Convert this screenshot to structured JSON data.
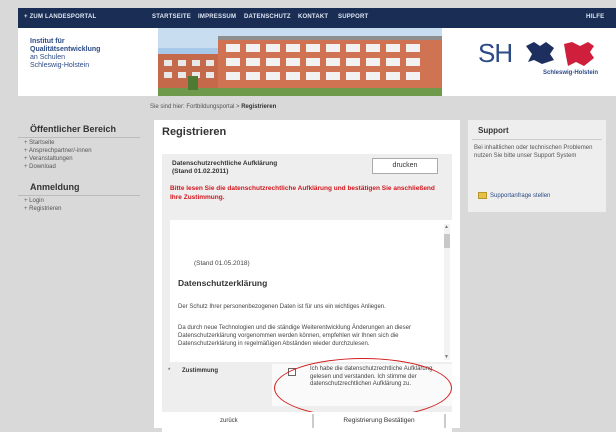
{
  "topnav": {
    "portal": "+ ZUM LANDESPORTAL",
    "items": [
      "STARTSEITE",
      "IMPRESSUM",
      "DATENSCHUTZ",
      "KONTAKT",
      "SUPPORT"
    ],
    "help": "HILFE"
  },
  "header": {
    "inst_line1": "Institut für",
    "inst_line2": "Qualitätsentwicklung",
    "inst_line3": "an Schulen",
    "inst_line4": "Schleswig-Holstein",
    "logo_text": "SH",
    "logo_sub": "Schleswig-Holstein"
  },
  "breadcrumb": {
    "prefix": "Sie sind hier: Fortbildungsportal > ",
    "current": "Registrieren"
  },
  "sidebar": {
    "section1": "Öffentlicher Bereich",
    "items1": [
      "Startseite",
      "Ansprechpartner/-innen",
      "Veranstaltungen",
      "Download"
    ],
    "section2": "Anmeldung",
    "items2": [
      "Login",
      "Registrieren"
    ]
  },
  "main": {
    "title": "Registrieren",
    "dsg_title_1": "Datenschutzrechtliche Aufklärung",
    "dsg_title_2": "(Stand 01.02.2011)",
    "print_label": "drucken",
    "warning": "Bitte lesen Sie die datenschutzrechtliche Aufklärung und bestätigen Sie anschließend Ihre Zustimmung.",
    "doc_stand": "(Stand 01.05.2018)",
    "doc_heading": "Datenschutzerklärung",
    "doc_p1": "Der Schutz Ihrer personenbezogenen Daten ist für uns ein wichtiges Anliegen.",
    "doc_p2": "Da durch neue Technologien und die ständige Weiterentwicklung Änderungen an dieser Datenschutzerklärung vorgenommen werden können, empfehlen wir Ihnen sich die Datenschutzerklärung in regelmäßigen Abständen wieder durchzulesen.",
    "consent_star": "*",
    "consent_label": "Zustimmung",
    "consent_text": "Ich habe die datenschutzrechtliche Aufklärung gelesen und verstanden. Ich stimme der datenschutzrechtlichen Aufklärung zu.",
    "back_label": "zurück",
    "confirm_label": "Registrierung Bestätigen"
  },
  "support": {
    "title": "Support",
    "text": "Bei inhaltlichen oder technischen Problemen nutzen Sie bitte unser Support System",
    "link": "Supportanfrage stellen"
  }
}
